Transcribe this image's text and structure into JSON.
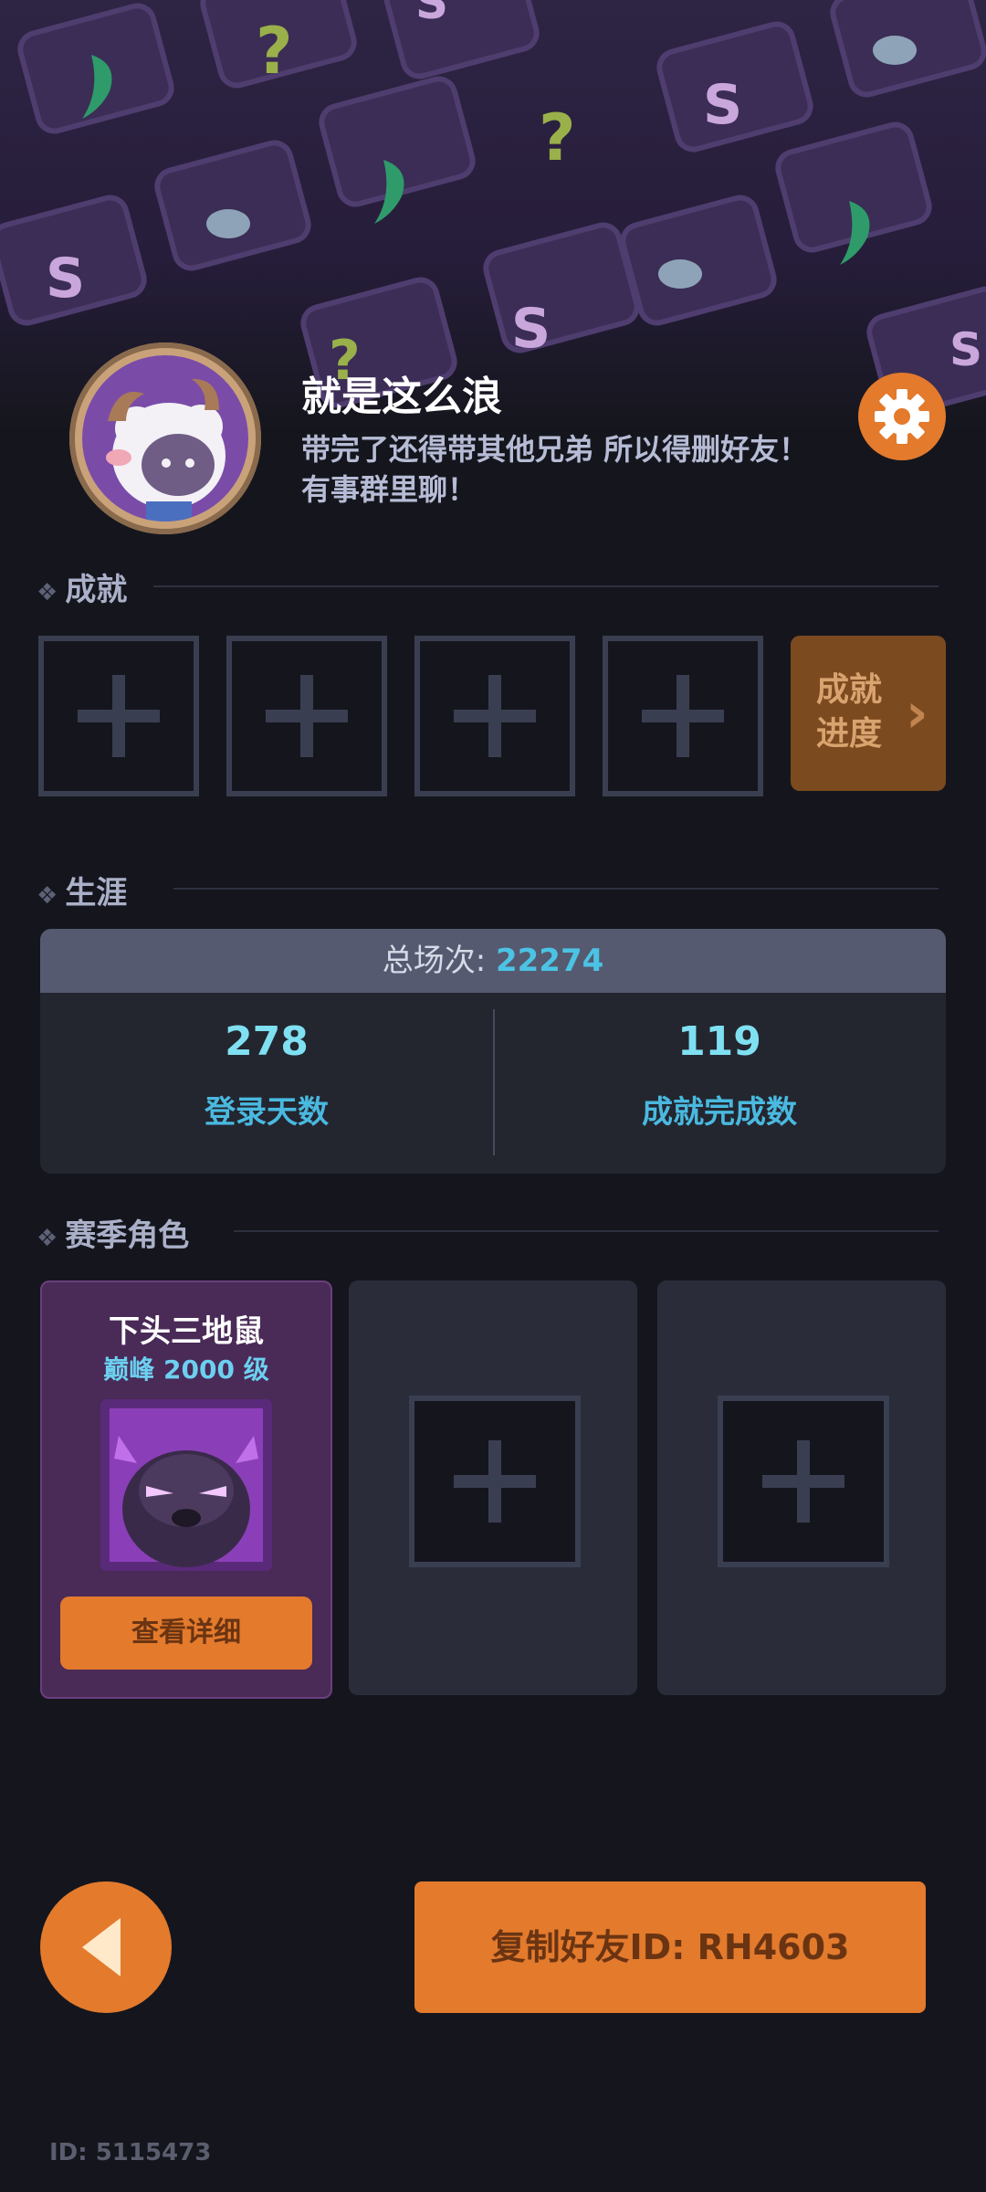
{
  "profile": {
    "name": "就是这么浪",
    "signature": "带完了还得带其他兄弟 所以得删好友！有事群里聊！"
  },
  "sections": {
    "achievements": "成就",
    "career": "生涯",
    "season_roles": "赛季角色"
  },
  "achievement_progress": {
    "label": "成就进度"
  },
  "career": {
    "total_label": "总场次:",
    "total_value": "22274",
    "stats": [
      {
        "value": "278",
        "label": "登录天数"
      },
      {
        "value": "119",
        "label": "成就完成数"
      }
    ]
  },
  "roles": [
    {
      "name": "下头三地鼠",
      "rank": "巅峰 2000 级",
      "button": "查看详细"
    }
  ],
  "footer": {
    "copy_button": "复制好友ID: RH4603",
    "id_text": "ID: 5115473"
  },
  "colors": {
    "accent": "#e37a2c",
    "background": "#15161d",
    "stat_value": "#7fe0f2"
  }
}
